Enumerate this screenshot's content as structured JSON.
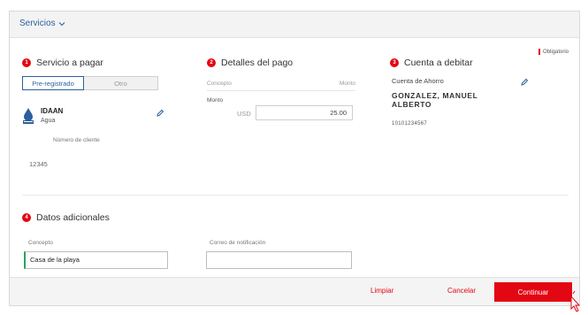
{
  "header": {
    "title": "Servicios"
  },
  "required_note": "Obligatorio",
  "sections": {
    "servicio": {
      "number": "1",
      "title": "Servicio a pagar",
      "tabs": [
        {
          "label": "Pre-registrado"
        },
        {
          "label": "Otro"
        }
      ],
      "service_name": "IDAAN",
      "service_type": "Agua",
      "client_number_label": "Número de cliente",
      "client_number": "12345"
    },
    "detalles": {
      "number": "2",
      "title": "Detalles del pago",
      "col_concept": "Concepto",
      "col_amount": "Monto",
      "amount_label": "Monto",
      "currency": "USD",
      "amount": "25.00"
    },
    "cuenta": {
      "number": "3",
      "title": "Cuenta a debitar",
      "account_type": "Cuenta de Ahorro",
      "holder_line1": "GONZALEZ, MANUEL",
      "holder_line2": "ALBERTO",
      "account_number": "10101234567"
    },
    "adicionales": {
      "number": "4",
      "title": "Datos adicionales",
      "concept_label": "Concepto",
      "concept_value": "Casa de la playa",
      "email_label": "Correo de notificación",
      "email_value": ""
    }
  },
  "footer": {
    "clear_label": "Limpiar",
    "cancel_label": "Cancelar",
    "continue_label": "Continuar"
  },
  "colors": {
    "accent": "#e30613",
    "link": "#2b5f9e",
    "focus": "#2aa35a"
  }
}
